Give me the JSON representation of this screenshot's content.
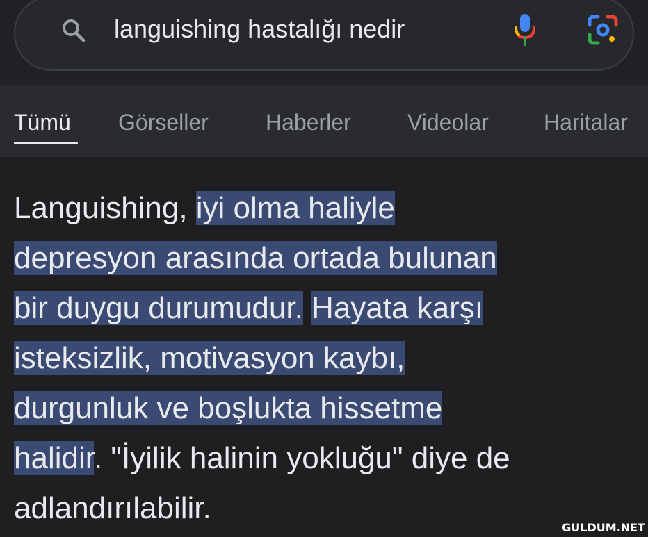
{
  "search": {
    "query": "languishing hastalığı nedir"
  },
  "tabs": [
    {
      "label": "Tümü",
      "active": true
    },
    {
      "label": "Görseller",
      "active": false
    },
    {
      "label": "Haberler",
      "active": false
    },
    {
      "label": "Videolar",
      "active": false
    },
    {
      "label": "Haritalar",
      "active": false
    }
  ],
  "answer": {
    "lines": [
      {
        "plain": "Languishing, ",
        "highlight": "iyi olma haliyle",
        "after": ""
      },
      {
        "plain": "",
        "highlight": "depresyon arasında ortada bulunan",
        "after": ""
      },
      {
        "plain": "",
        "highlight": "bir duygu durumudur.",
        "mid": " ",
        "highlight2": "Hayata karşı",
        "after": ""
      },
      {
        "plain": "",
        "highlight": "isteksizlik, motivasyon kaybı,",
        "after": ""
      },
      {
        "plain": "",
        "highlight": "durgunluk ve boşlukta hissetme",
        "after": ""
      },
      {
        "plain": "",
        "highlight": "halidir",
        "after": ". \"İyilik halinin yokluğu\" diye de"
      },
      {
        "plain": "adlandırılabilir.",
        "highlight": "",
        "after": ""
      }
    ]
  },
  "watermark": "GULDUM.NET",
  "colors": {
    "background": "#202124",
    "highlight": "#3a4a73",
    "text": "#e8eaed",
    "tab_inactive": "#9aa0a6"
  }
}
